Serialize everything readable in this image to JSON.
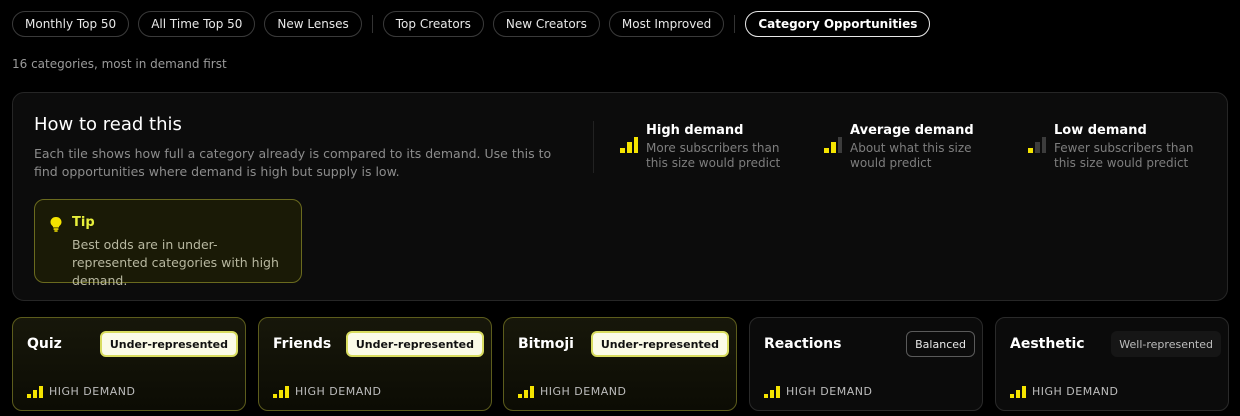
{
  "tabs": [
    {
      "label": "Monthly Top 50",
      "active": false
    },
    {
      "label": "All Time Top 50",
      "active": false
    },
    {
      "label": "New Lenses",
      "active": false
    },
    {
      "label": "Top Creators",
      "active": false
    },
    {
      "label": "New Creators",
      "active": false
    },
    {
      "label": "Most Improved",
      "active": false
    },
    {
      "label": "Category Opportunities",
      "active": true
    }
  ],
  "subtitle": "16 categories, most in demand first",
  "info": {
    "title": "How to read this",
    "description": "Each tile shows how full a category already is compared to its demand. Use this to find opportunities where demand is high but supply is low.",
    "legend": [
      {
        "title": "High demand",
        "description": "More subscribers than this size would predict",
        "level": 3
      },
      {
        "title": "Average demand",
        "description": "About what this size would predict",
        "level": 2
      },
      {
        "title": "Low demand",
        "description": "Fewer subscribers than this size would predict",
        "level": 1
      }
    ],
    "tip": {
      "icon": "lightbulb-icon",
      "title": "Tip",
      "text": "Best odds are in under-represented categories with high demand."
    }
  },
  "cards": [
    {
      "name": "Quiz",
      "badge": "Under-represented",
      "badge_type": "under",
      "demand": "HIGH DEMAND",
      "level": 3
    },
    {
      "name": "Friends",
      "badge": "Under-represented",
      "badge_type": "under",
      "demand": "HIGH DEMAND",
      "level": 3
    },
    {
      "name": "Bitmoji",
      "badge": "Under-represented",
      "badge_type": "under",
      "demand": "HIGH DEMAND",
      "level": 3
    },
    {
      "name": "Reactions",
      "badge": "Balanced",
      "badge_type": "balanced",
      "demand": "HIGH DEMAND",
      "level": 3
    },
    {
      "name": "Aesthetic",
      "badge": "Well-represented",
      "badge_type": "well",
      "demand": "HIGH DEMAND",
      "level": 3
    }
  ],
  "colors": {
    "accent": "#f5e400",
    "bar_inactive": "#3c3c3c",
    "tip_title": "#e7ef3b"
  }
}
